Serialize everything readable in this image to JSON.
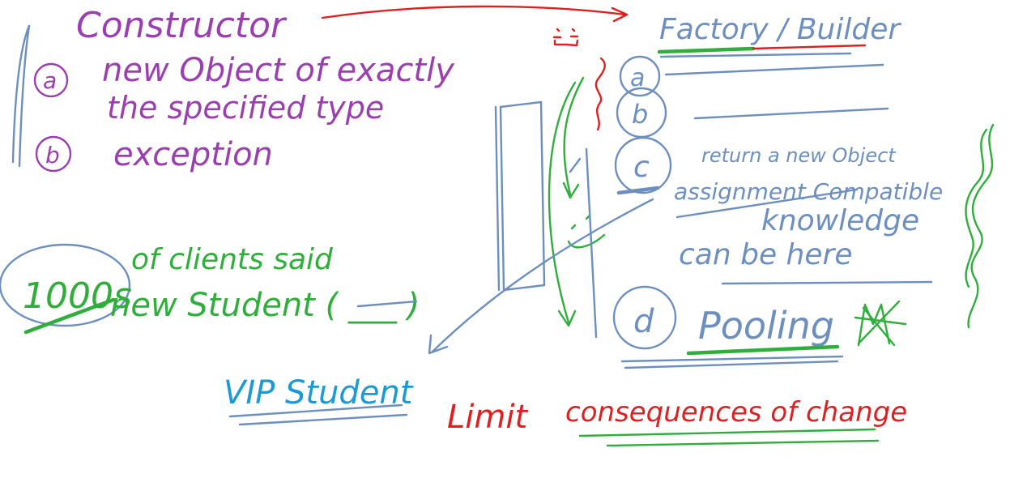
{
  "constructor_notes": {
    "title": "Constructor",
    "item_a_marker": "a",
    "item_a_line1": "new Object of exactly",
    "item_a_line2": "the specified type",
    "item_b_marker": "b",
    "item_b_text": "exception"
  },
  "factory_notes": {
    "title": "Factory / Builder",
    "item_a_marker": "a",
    "item_b_marker": "b",
    "item_c_marker": "c",
    "item_c_line1": "return a new Object",
    "item_c_line2": "assignment Compatible",
    "item_c_line3": "knowledge",
    "item_c_line4": "can be here",
    "item_d_marker": "d",
    "item_d_text": "Pooling"
  },
  "client_notes": {
    "count": "1000s",
    "line1": "of clients said",
    "line2": "new Student ( ___ )",
    "vip": "VIP Student"
  },
  "bottom_note": {
    "part1": "Limit",
    "part2": "consequences of change"
  },
  "colors": {
    "purple": "#9b3fb0",
    "blue": "#6d8fbf",
    "green": "#2fae3c",
    "red": "#e02020",
    "cyan": "#1b9ad6"
  }
}
